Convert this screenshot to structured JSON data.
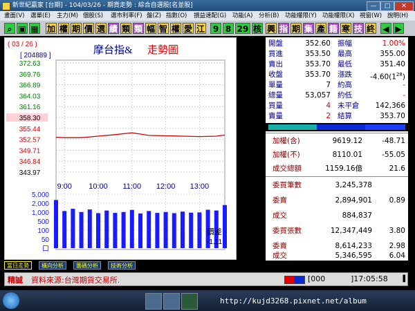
{
  "window": {
    "title": "新世紀贏家 [台期] - 104/03/26 - 期貨走勢 : 綜合自選股[名並股]",
    "controls": {
      "minimize": "—",
      "maximize": "□",
      "close": "✕"
    }
  },
  "menu": {
    "items": [
      "畫面(V)",
      "選單(E)",
      "主力(M)",
      "個股(S)",
      "選市利率(F)",
      "盤(Z)",
      "指數(O)",
      "損益速配(G)",
      "功能(A)",
      "分析(B)",
      "功能權限(Y)",
      "功能權限(X)",
      "視窗(W)",
      "說明(H)"
    ]
  },
  "toolbar": {
    "buttons": [
      "加",
      "權",
      "期",
      "價",
      "選",
      "績",
      "類",
      "類",
      "幅",
      "智",
      "權",
      "愛",
      "江",
      "9",
      "8",
      "29",
      "核",
      "興",
      "指",
      "期",
      "集",
      "產",
      "籍",
      "寒",
      "技",
      "終"
    ]
  },
  "chart": {
    "date_label": "( 03 / 26 )",
    "volume_total_label": "[ 204889 ]",
    "title": "摩台指&",
    "title2": "走勢圖",
    "spread_label": "價差",
    "spread_value": "-1.11"
  },
  "chart_data": {
    "type": "line",
    "y_ticks": [
      "372.63",
      "369.76",
      "366.89",
      "364.03",
      "361.16",
      "358.30",
      "355.44",
      "352.57",
      "349.71",
      "346.84",
      "343.97"
    ],
    "ylim": [
      343.97,
      372.63
    ],
    "reference_price": 358.3,
    "x_ticks": [
      "9:00",
      "10:00",
      "11:00",
      "12:00",
      "13:00"
    ],
    "volume_ticks": [
      "5,000",
      "2,000",
      "1,000",
      "500",
      "100",
      "50",
      "口"
    ],
    "price_series": {
      "name": "price",
      "x": [
        "08:45",
        "09:00",
        "09:30",
        "10:00",
        "10:30",
        "11:00",
        "11:30",
        "12:00",
        "12:30",
        "13:00",
        "13:30",
        "13:45"
      ],
      "y": [
        353.1,
        353.0,
        353.0,
        353.4,
        353.8,
        354.3,
        353.6,
        353.5,
        353.4,
        353.3,
        353.4,
        353.7
      ]
    },
    "volume_series": {
      "name": "volume",
      "x": [
        "08:45",
        "09:00",
        "09:15",
        "09:30",
        "09:45",
        "10:00",
        "10:15",
        "10:30",
        "10:45",
        "11:00",
        "11:15",
        "11:30",
        "11:45",
        "12:00",
        "12:15",
        "12:30",
        "12:45",
        "13:00",
        "13:15",
        "13:30",
        "13:45"
      ],
      "y": [
        2000,
        350,
        500,
        300,
        450,
        250,
        380,
        260,
        300,
        420,
        240,
        350,
        260,
        300,
        250,
        320,
        270,
        280,
        430,
        380,
        900
      ]
    }
  },
  "quote": {
    "open_label": "開盤",
    "open": "352.60",
    "amp_label": "振幅",
    "amp": "1.00%",
    "bid_label": "買進",
    "bid": "353.50",
    "high_label": "最高",
    "high": "355.00",
    "ask_label": "賣出",
    "ask": "353.70",
    "low_label": "最低",
    "low": "351.40",
    "close_label": "收盤",
    "close": "353.70",
    "chg_label": "漲跌",
    "chg": "-4.60(1",
    "chg_sup": "28",
    "chg_tail": ")",
    "unit_label": "單量",
    "unit": "7",
    "est_high_label": "約高",
    "est_high": "-",
    "total_label": "總量",
    "total": "53,057",
    "est_low_label": "約低",
    "est_low": "-",
    "buy_vol_label": "買量",
    "buy_vol": "4",
    "oi_label": "未平倉",
    "oi": "142,366",
    "sell_vol_label": "賣量",
    "sell_vol": "2",
    "settle_label": "結算",
    "settle": "353.70"
  },
  "market": {
    "weighted_label": "加權(含)",
    "weighted": "9619.12",
    "weighted_chg": "-48.71",
    "weighted_ex_label": "加權(不)",
    "weighted_ex": "8110.01",
    "weighted_ex_chg": "-55.05",
    "turnover_label": "成交總額",
    "turnover": "1159.16億",
    "turnover_pct": "21.6",
    "buy_orders_label": "委買筆數",
    "buy_orders": "3,245,378",
    "sell_orders_label": "委賣",
    "sell_orders": "2,894,901",
    "sell_orders_ratio": "0.89",
    "deal_label": "成交",
    "deal": "884,837",
    "buy_lots_label": "委買張數",
    "buy_lots": "12,347,449",
    "buy_lots_ratio": "3.80",
    "sell_lots_label": "委賣",
    "sell_lots": "8,614,233",
    "sell_lots_ratio": "2.98",
    "deal_lots_label": "成交",
    "deal_lots": "5,346,595",
    "deal_lots_ratio": "6.04"
  },
  "tabs": [
    "當日走勢",
    "橫向分析",
    "籌碼分析",
    "技術分析"
  ],
  "status": {
    "brand": "精誠",
    "source": "資料來源:台灣期貨交易所.",
    "count": "000",
    "time": "17:05:58"
  },
  "watermark": "http://kujd3268.pixnet.net/album",
  "colors": {
    "accent_red": "#e00000",
    "line_red": "#d00000",
    "volume_blue": "#1a1aff",
    "label_navy": "#00008b",
    "dark_red": "#8b0000"
  }
}
